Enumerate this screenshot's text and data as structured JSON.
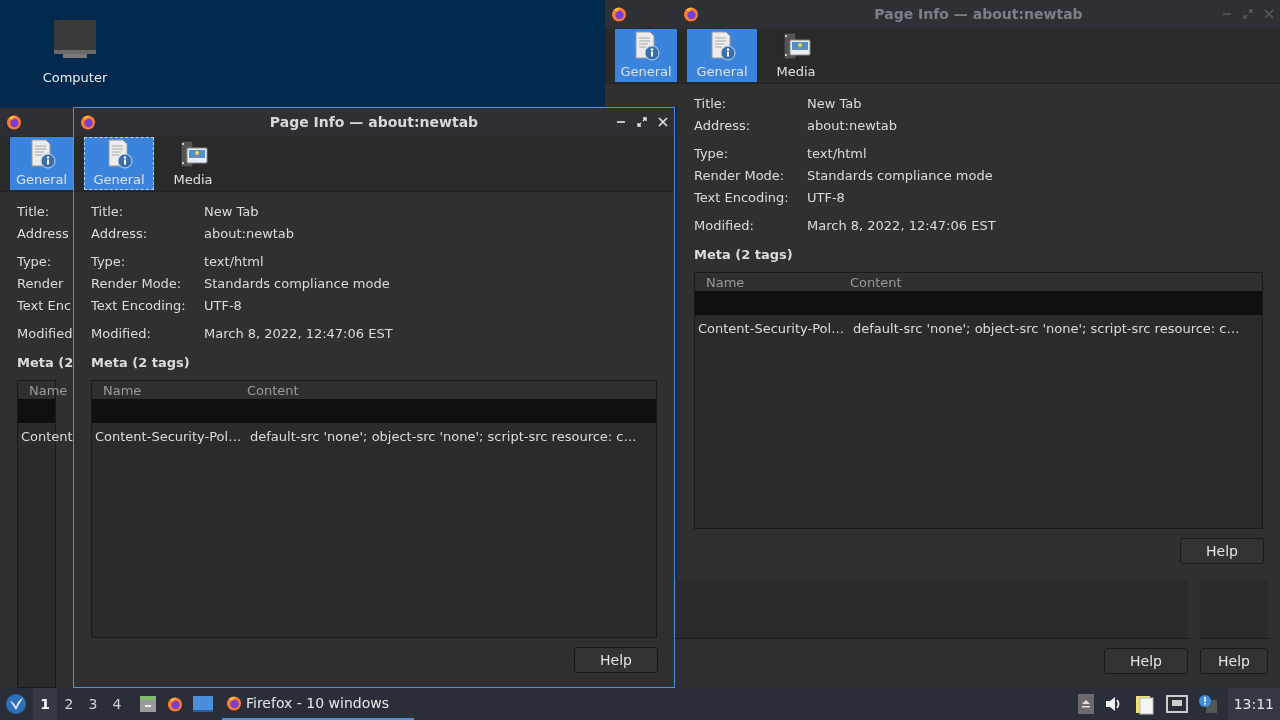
{
  "desktop": {
    "icons": [
      {
        "label": "Computer"
      }
    ]
  },
  "windows": [
    {
      "kind": "dialog",
      "active": false,
      "tabs": [
        {
          "label": "General",
          "kind": "info",
          "selected": true
        }
      ]
    },
    {
      "kind": "dialog",
      "active": false,
      "title": "Page Info — about:newtab",
      "tabs": [
        {
          "label": "General",
          "kind": "info",
          "selected": true
        },
        {
          "label": "Media",
          "kind": "media",
          "selected": false
        }
      ],
      "field_groups": [
        [
          {
            "label": "Title:",
            "value": "New Tab"
          },
          {
            "label": "Address:",
            "value": "about:newtab"
          }
        ],
        [
          {
            "label": "Type:",
            "value": "text/html"
          },
          {
            "label": "Render Mode:",
            "value": "Standards compliance mode"
          },
          {
            "label": "Text Encoding:",
            "value": "UTF-8"
          }
        ],
        [
          {
            "label": "Modified:",
            "value": "March 8, 2022, 12:47:06 EST"
          }
        ]
      ],
      "meta_heading": "Meta (2 tags)",
      "table": {
        "columns": [
          "Name",
          "Content"
        ],
        "rows": [
          {
            "kind": "blank"
          },
          {
            "kind": "entry",
            "cells": [
              "Content-Security-Pol…",
              "default-src 'none'; object-src 'none'; script-src resource: c…"
            ]
          }
        ]
      },
      "help_button": "Help"
    },
    {
      "kind": "dialog",
      "active": false,
      "tabs": [
        {
          "label": "General",
          "kind": "info",
          "selected": true
        }
      ],
      "field_groups": [
        [
          {
            "label": "Title:"
          },
          {
            "label": "Address"
          }
        ],
        [
          {
            "label": "Type:"
          },
          {
            "label": "Render"
          },
          {
            "label": "Text Enc"
          }
        ],
        [
          {
            "label": "Modified"
          }
        ]
      ],
      "meta_heading": "Meta (2",
      "table": {
        "columns": [
          "Name"
        ],
        "rows": [
          {
            "kind": "blank"
          },
          {
            "kind": "entry",
            "cells": [
              "Content"
            ]
          }
        ]
      }
    },
    {
      "kind": "dialog",
      "active": true,
      "title": "Page Info — about:newtab",
      "tabs": [
        {
          "label": "General",
          "kind": "info",
          "selected": true
        },
        {
          "label": "Media",
          "kind": "media",
          "selected": false
        }
      ],
      "field_groups": [
        [
          {
            "label": "Title:",
            "value": "New Tab"
          },
          {
            "label": "Address:",
            "value": "about:newtab"
          }
        ],
        [
          {
            "label": "Type:",
            "value": "text/html"
          },
          {
            "label": "Render Mode:",
            "value": "Standards compliance mode"
          },
          {
            "label": "Text Encoding:",
            "value": "UTF-8"
          }
        ],
        [
          {
            "label": "Modified:",
            "value": "March 8, 2022, 12:47:06 EST"
          }
        ]
      ],
      "meta_heading": "Meta (2 tags)",
      "table": {
        "columns": [
          "Name",
          "Content"
        ],
        "rows": [
          {
            "kind": "blank"
          },
          {
            "kind": "entry",
            "cells": [
              "Content-Security-Pol…",
              "default-src 'none'; object-src 'none'; script-src resource: c…"
            ]
          }
        ]
      },
      "help_button": "Help"
    },
    {
      "kind": "footer",
      "help_button": "Help"
    },
    {
      "kind": "footer",
      "help_button": "Help"
    }
  ],
  "taskbar": {
    "workspaces": [
      {
        "label": "1",
        "selected": true
      },
      {
        "label": "2",
        "selected": false
      },
      {
        "label": "3",
        "selected": false
      },
      {
        "label": "4",
        "selected": false
      }
    ],
    "tasks": [
      {
        "label": "Firefox - 10 windows",
        "selected": true
      }
    ],
    "clock": "13:11"
  }
}
